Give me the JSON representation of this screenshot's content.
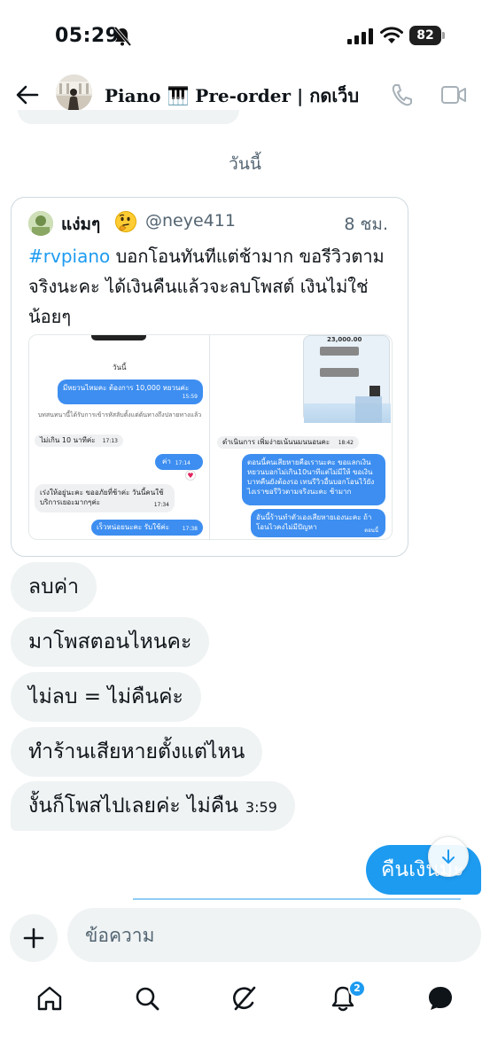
{
  "status_bar": {
    "time": "05:29",
    "battery": "82"
  },
  "header": {
    "title": "Piano 🎹 Pre-order | กดเว็บ"
  },
  "day_separator": "วันนี้",
  "quoted_tweet": {
    "author_name": "แง่มๆ",
    "author_emoji": "thinking-face",
    "handle": "@neye411",
    "time": "8 ชม.",
    "hashtag": "#rvpiano",
    "text_rest": " บอกโอนทันทีแต่ช้ามาก ขอรีวิวตามจริงนะคะ ได้เงินคืนแล้วจะลบโพสต์ เงินไม่ใช่น้อยๆ",
    "media_left": {
      "day": "วันนี้",
      "msg1": "มีหยวนไหมคะ ต้องการ 10,000 หยวนค่ะ",
      "msg1_time": "15:59",
      "notice": "บทสนทนานี้ได้รับการเข้ารหัสลับตั้งแต่ต้นทางถึงปลายทางแล้ว",
      "msg2_partial": "ไม่เกิน 10 นาทีค่ะ",
      "msg2_time": "17:13",
      "msg3": "ค่า",
      "msg3_time": "17:14",
      "msg4": "เร่งให้อยู่นะคะ ขออภัยที่ช้าค่ะ วันนี้คนใช้บริการเยอะมากๆค่ะ",
      "msg4_time": "17:34",
      "msg5": "เร็วหน่อยนะคะ รับใช้ค่ะ",
      "msg5_time": "17:38"
    },
    "media_right": {
      "amount_partial": "23,000.00",
      "msg1_partial": "ดำเนินการ เพิ่มง่ายเน้นนมนนอนคะ",
      "msg1_time": "18:42",
      "msg2": "ตอนนี้คนเสียหายคือเรานะคะ ขอแลกเงินหยวนบอกไม่เกิน10นาทีแต่ไม่มีให้ ขอเงินบาทคืนยังต้องรอ เทนรีวิวอื่นบอกโอนไว้ยังไงเราขอรีวิวตามจริงนะคะ ช้ามาก",
      "msg3": "อันนี้ร้านทำตัวเองเสียหายเองนะคะ ถ้าโอนไวคงไม่มีปัญหา",
      "msg3_status": "ตอนนี้"
    }
  },
  "messages": [
    {
      "text": "ลบค่า"
    },
    {
      "text": "มาโพสตอนไหนคะ"
    },
    {
      "text": "ไม่ลบ = ไม่คืนค่ะ"
    },
    {
      "text": "ทำร้านเสียหายตั้งแต่ไหน"
    },
    {
      "text": "งั้นก็โพสไปเลยค่ะ ไม่คืน",
      "time": "3:59"
    }
  ],
  "sent_message": {
    "text": "คืนเงินมะ"
  },
  "composer": {
    "placeholder": "ข้อความ"
  },
  "bottom_nav": {
    "notifications_badge": "2"
  },
  "colors": {
    "accent": "#1d9bf0",
    "bubble": "#eff3f4",
    "secondary_text": "#536471"
  }
}
